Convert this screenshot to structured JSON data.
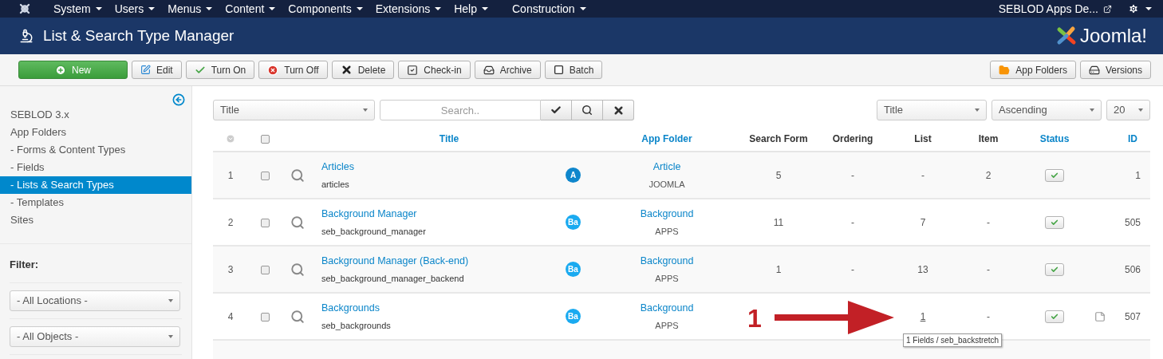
{
  "top_menu": {
    "items": [
      "System",
      "Users",
      "Menus",
      "Content",
      "Components",
      "Extensions",
      "Help",
      "Construction"
    ],
    "site_link": "SEBLOD Apps De..."
  },
  "header": {
    "title": "List & Search Type Manager",
    "logo_text": "Joomla!"
  },
  "toolbar": {
    "left": [
      {
        "label": "New",
        "kind": "primary"
      },
      {
        "label": "Edit",
        "kind": "default"
      },
      {
        "label": "Turn On",
        "kind": "default"
      },
      {
        "label": "Turn Off",
        "kind": "default"
      },
      {
        "label": "Delete",
        "kind": "default"
      },
      {
        "label": "Check-in",
        "kind": "default"
      },
      {
        "label": "Archive",
        "kind": "default"
      },
      {
        "label": "Batch",
        "kind": "default"
      }
    ],
    "right": [
      {
        "label": "App Folders"
      },
      {
        "label": "Versions"
      }
    ]
  },
  "sidebar": {
    "items": [
      {
        "label": "SEBLOD 3.x",
        "selected": false
      },
      {
        "label": "App Folders",
        "selected": false
      },
      {
        "label": "- Forms & Content Types",
        "selected": false
      },
      {
        "label": "- Fields",
        "selected": false
      },
      {
        "label": "- Lists & Search Types",
        "selected": true
      },
      {
        "label": "- Templates",
        "selected": false
      },
      {
        "label": "Sites",
        "selected": false
      }
    ],
    "filter_title": "Filter:",
    "filters": [
      "- All Locations -",
      "- All Objects -"
    ]
  },
  "search_bar": {
    "field_select": "Title",
    "placeholder": "Search..",
    "sort_by": "Title",
    "direction": "Ascending",
    "limit": "20"
  },
  "table": {
    "select_all_checked": false,
    "columns": [
      {
        "label": "Title",
        "sortable": true
      },
      {
        "label": "App Folder",
        "sortable": true
      },
      {
        "label": "Search Form",
        "sortable": false
      },
      {
        "label": "Ordering",
        "sortable": false
      },
      {
        "label": "List",
        "sortable": false
      },
      {
        "label": "Item",
        "sortable": false
      },
      {
        "label": "Status",
        "sortable": true
      },
      {
        "label": "ID",
        "sortable": true
      }
    ],
    "rows": [
      {
        "number": "1",
        "checked": false,
        "title": "Articles",
        "alias": "articles",
        "badge": "A",
        "color": "#0f86cc",
        "folder": "Article",
        "folder_group": "JOOMLA",
        "search_form": "5",
        "ordering": "-",
        "list": "-",
        "item": "2",
        "published": true,
        "note": false,
        "list_hovered": false,
        "id": "1"
      },
      {
        "number": "2",
        "checked": false,
        "title": "Background Manager",
        "alias": "seb_background_manager",
        "badge": "Ba",
        "color": "#1aaaf0",
        "folder": "Background",
        "folder_group": "APPS",
        "search_form": "11",
        "ordering": "-",
        "list": "7",
        "item": "-",
        "published": true,
        "note": false,
        "list_hovered": false,
        "id": "505"
      },
      {
        "number": "3",
        "checked": false,
        "title": "Background Manager (Back-end)",
        "alias": "seb_background_manager_backend",
        "badge": "Ba",
        "color": "#1aaaf0",
        "folder": "Background",
        "folder_group": "APPS",
        "search_form": "1",
        "ordering": "-",
        "list": "13",
        "item": "-",
        "published": true,
        "note": false,
        "list_hovered": false,
        "id": "506"
      },
      {
        "number": "4",
        "checked": false,
        "title": "Backgrounds",
        "alias": "seb_backgrounds",
        "badge": "Ba",
        "color": "#1aaaf0",
        "folder": "Background",
        "folder_group": "APPS",
        "search_form": "",
        "ordering": "",
        "list": "1",
        "item": "-",
        "published": true,
        "note": true,
        "list_hovered": true,
        "id": "507"
      }
    ]
  },
  "annotation": {
    "label": "1"
  },
  "tooltip": {
    "text": "1 Fields / seb_backstretch"
  }
}
